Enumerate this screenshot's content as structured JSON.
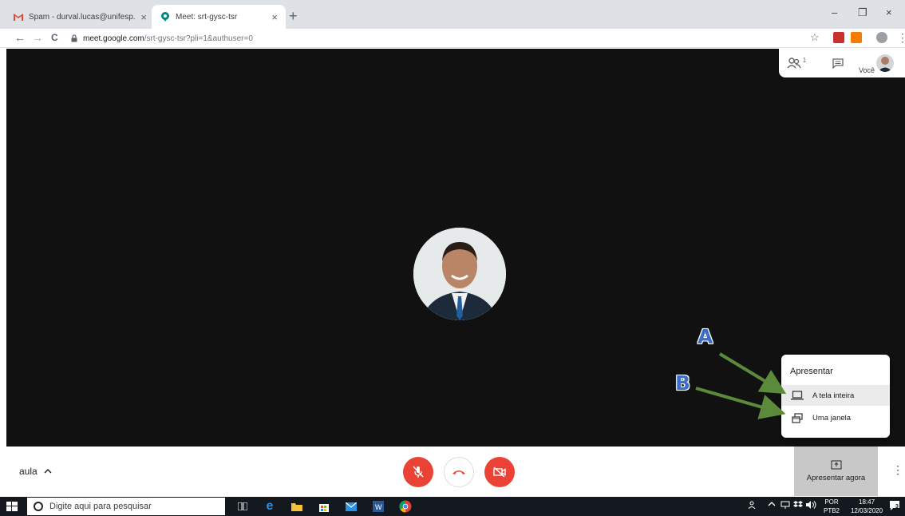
{
  "browser": {
    "tabs": [
      {
        "title": "Spam - durval.lucas@unifesp.br - ",
        "favicon": "gmail-icon",
        "active": false
      },
      {
        "title": "Meet: srt-gysc-tsr",
        "favicon": "meet-icon",
        "active": true
      }
    ],
    "tab_close": "×",
    "new_tab": "+",
    "window_controls": {
      "minimize": "–",
      "restore": "❐",
      "close": "×"
    },
    "nav": {
      "back": "←",
      "forward": "→",
      "reload": "C"
    },
    "url": {
      "host": "meet.google.com",
      "path": "/srt-gysc-tsr?pli=1&authuser=0"
    },
    "star": "☆",
    "more": "⋮"
  },
  "meet": {
    "top_panel": {
      "participants_count": "1",
      "you_label": "Você"
    },
    "present_menu": {
      "title": "Apresentar",
      "items": [
        {
          "label": "A tela inteira",
          "icon": "laptop-icon",
          "selected": true
        },
        {
          "label": "Uma janela",
          "icon": "window-icon",
          "selected": false
        }
      ]
    },
    "annotations": {
      "a": "A",
      "b": "B"
    },
    "bottom": {
      "meeting_name": "aula",
      "meeting_chevron": "^",
      "present_now_label": "Apresentar agora",
      "more": "⋮"
    }
  },
  "taskbar": {
    "search_placeholder": "Digite aqui para pesquisar",
    "tray": {
      "lang_top": "POR",
      "lang_bottom": "PTB2",
      "time": "18:47",
      "date": "12/03/2020",
      "notif_count": "3"
    }
  },
  "colors": {
    "stage_bg": "#111111",
    "danger": "#ea4335",
    "arrow_green": "#5a8a3a",
    "annotation_blue": "#3d6ec5",
    "taskbar_bg": "#14181f"
  }
}
